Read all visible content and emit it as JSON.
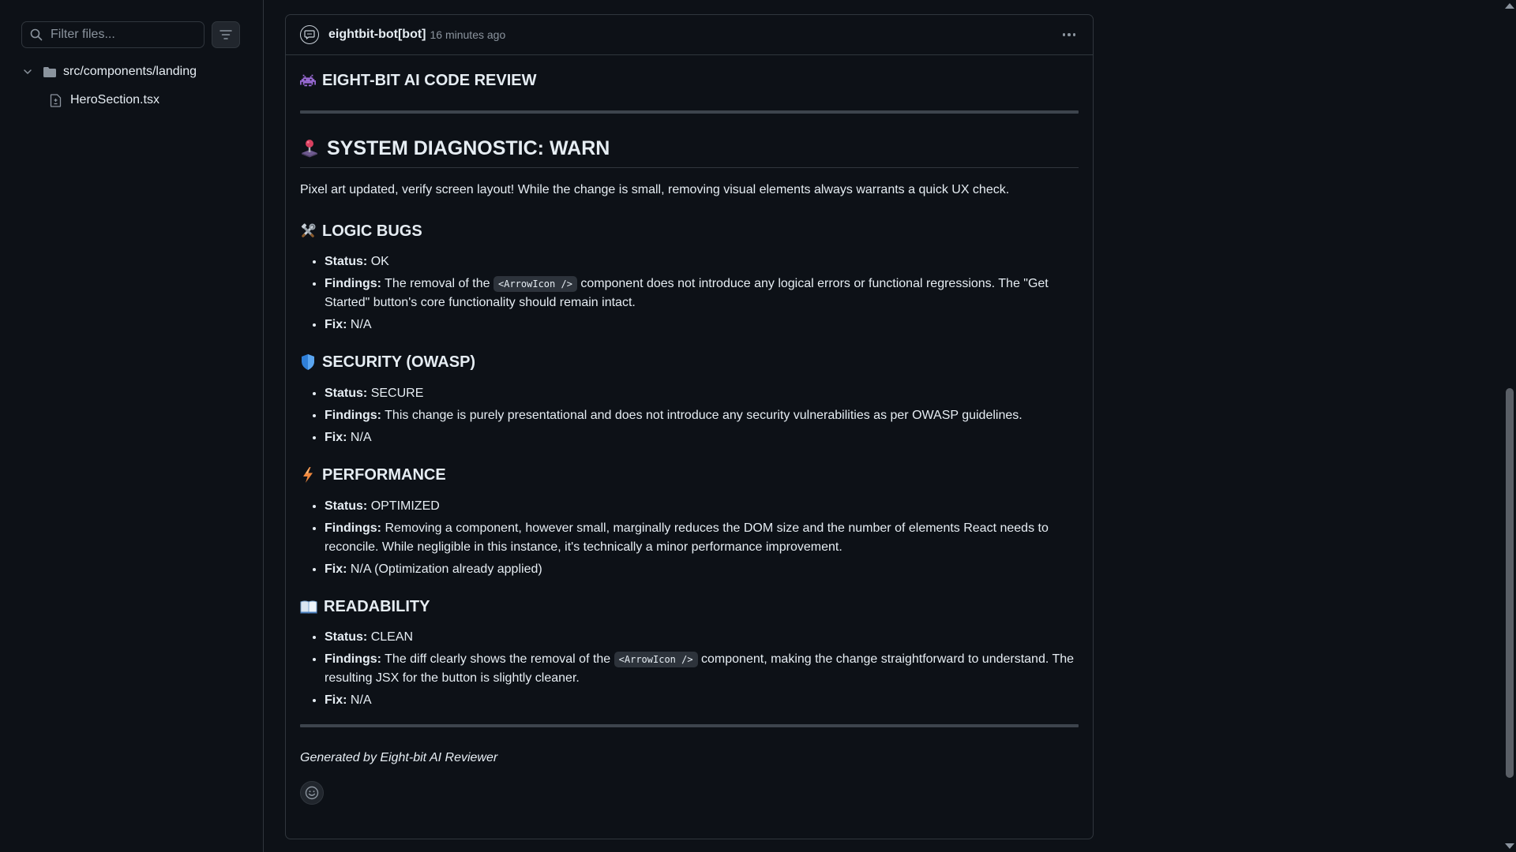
{
  "sidebar": {
    "filter_placeholder": "Filter files...",
    "folder": "src/components/landing",
    "file": "HeroSection.tsx"
  },
  "comment": {
    "author": "eightbit-bot[bot]",
    "timestamp": "16 minutes ago",
    "title": "EIGHT-BIT AI CODE REVIEW",
    "diagnostic_heading": "SYSTEM DIAGNOSTIC: WARN",
    "summary": "Pixel art updated, verify screen layout! While the change is small, removing visual elements always warrants a quick UX check.",
    "sections": [
      {
        "icon": "tools-icon",
        "heading": "LOGIC BUGS",
        "status_label": "Status:",
        "status": "OK",
        "findings_label": "Findings:",
        "findings_pre": "The removal of the",
        "findings_code": "<ArrowIcon />",
        "findings_post": "component does not introduce any logical errors or functional regressions. The \"Get Started\" button's core functionality should remain intact.",
        "fix_label": "Fix:",
        "fix": "N/A"
      },
      {
        "icon": "shield-icon",
        "heading": "SECURITY (OWASP)",
        "status_label": "Status:",
        "status": "SECURE",
        "findings_label": "Findings:",
        "findings_pre": "This change is purely presentational and does not introduce any security vulnerabilities as per OWASP guidelines.",
        "findings_code": "",
        "findings_post": "",
        "fix_label": "Fix:",
        "fix": "N/A"
      },
      {
        "icon": "lightning-icon",
        "heading": "PERFORMANCE",
        "status_label": "Status:",
        "status": "OPTIMIZED",
        "findings_label": "Findings:",
        "findings_pre": "Removing a component, however small, marginally reduces the DOM size and the number of elements React needs to reconcile. While negligible in this instance, it's technically a minor performance improvement.",
        "findings_code": "",
        "findings_post": "",
        "fix_label": "Fix:",
        "fix": "N/A (Optimization already applied)"
      },
      {
        "icon": "book-icon",
        "heading": "READABILITY",
        "status_label": "Status:",
        "status": "CLEAN",
        "findings_label": "Findings:",
        "findings_pre": "The diff clearly shows the removal of the",
        "findings_code": "<ArrowIcon />",
        "findings_post": "component, making the change straightforward to understand. The resulting JSX for the button is slightly cleaner.",
        "fix_label": "Fix:",
        "fix": "N/A"
      }
    ],
    "footer": "Generated by Eight-bit AI Reviewer"
  }
}
